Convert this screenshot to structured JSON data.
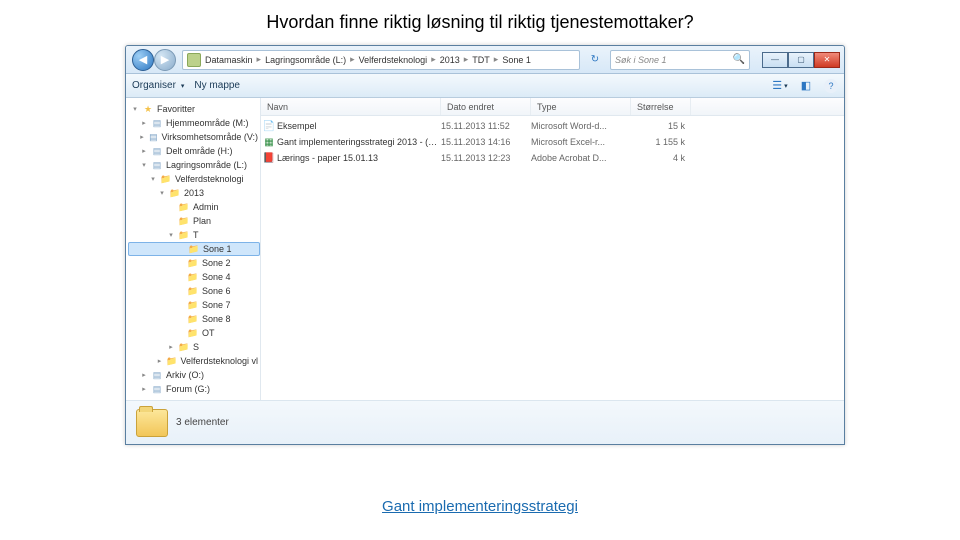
{
  "slide": {
    "title": "Hvordan finne riktig løsning til riktig tjenestemottaker?",
    "link": "Gant implementeringsstrategi"
  },
  "window": {
    "breadcrumb": [
      "Datamaskin",
      "Lagringsområde (L:)",
      "Velferdsteknologi",
      "2013",
      "TDT",
      "Sone 1"
    ],
    "search_placeholder": "Søk i Sone 1",
    "nav_back_glyph": "◀",
    "nav_fwd_glyph": "▶",
    "win_min": "—",
    "win_max": "▢",
    "win_close": "✕"
  },
  "toolbar": {
    "organize": "Organiser",
    "new_folder": "Ny mappe"
  },
  "columns": {
    "name": "Navn",
    "date": "Dato endret",
    "type": "Type",
    "size": "Størrelse"
  },
  "sidebar": [
    {
      "depth": 0,
      "arrow": "▾",
      "icon": "★",
      "cls": "ic-fav",
      "label": "Favoritter",
      "interact": true
    },
    {
      "depth": 1,
      "arrow": "▸",
      "icon": "▤",
      "cls": "ic-drv",
      "label": "Hjemmeområde (M:)",
      "interact": true
    },
    {
      "depth": 1,
      "arrow": "▸",
      "icon": "▤",
      "cls": "ic-drv",
      "label": "Virksomhetsområde (V:)",
      "interact": true
    },
    {
      "depth": 1,
      "arrow": "▸",
      "icon": "▤",
      "cls": "ic-drv",
      "label": "Delt område (H:)",
      "interact": true
    },
    {
      "depth": 1,
      "arrow": "▾",
      "icon": "▤",
      "cls": "ic-drv",
      "label": "Lagringsområde (L:)",
      "interact": true
    },
    {
      "depth": 2,
      "arrow": "▾",
      "icon": "📁",
      "cls": "ic-fold",
      "label": "Velferdsteknologi",
      "interact": true
    },
    {
      "depth": 3,
      "arrow": "▾",
      "icon": "📁",
      "cls": "ic-fold",
      "label": "2013",
      "interact": true
    },
    {
      "depth": 4,
      "arrow": " ",
      "icon": "📁",
      "cls": "ic-fold",
      "label": "Admin",
      "interact": true
    },
    {
      "depth": 4,
      "arrow": " ",
      "icon": "📁",
      "cls": "ic-fold",
      "label": "Plan",
      "interact": true
    },
    {
      "depth": 4,
      "arrow": "▾",
      "icon": "📁",
      "cls": "ic-fold",
      "label": "T",
      "interact": true
    },
    {
      "depth": 5,
      "arrow": " ",
      "icon": "📁",
      "cls": "ic-fold",
      "label": "Sone 1",
      "interact": true,
      "selected": true
    },
    {
      "depth": 5,
      "arrow": " ",
      "icon": "📁",
      "cls": "ic-fold",
      "label": "Sone 2",
      "interact": true
    },
    {
      "depth": 5,
      "arrow": " ",
      "icon": "📁",
      "cls": "ic-fold",
      "label": "Sone 4",
      "interact": true
    },
    {
      "depth": 5,
      "arrow": " ",
      "icon": "📁",
      "cls": "ic-fold",
      "label": "Sone 6",
      "interact": true
    },
    {
      "depth": 5,
      "arrow": " ",
      "icon": "📁",
      "cls": "ic-fold",
      "label": "Sone 7",
      "interact": true
    },
    {
      "depth": 5,
      "arrow": " ",
      "icon": "📁",
      "cls": "ic-fold",
      "label": "Sone 8",
      "interact": true
    },
    {
      "depth": 5,
      "arrow": " ",
      "icon": "📁",
      "cls": "ic-fold",
      "label": "OT",
      "interact": true
    },
    {
      "depth": 4,
      "arrow": "▸",
      "icon": "📁",
      "cls": "ic-fold",
      "label": "S",
      "interact": true
    },
    {
      "depth": 3,
      "arrow": "▸",
      "icon": "📁",
      "cls": "ic-fold",
      "label": "Velferdsteknologi vl",
      "interact": true
    },
    {
      "depth": 1,
      "arrow": "▸",
      "icon": "▤",
      "cls": "ic-drv",
      "label": "Arkiv (O:)",
      "interact": true
    },
    {
      "depth": 1,
      "arrow": "▸",
      "icon": "▤",
      "cls": "ic-drv",
      "label": "Forum (G:)",
      "interact": true
    }
  ],
  "files": [
    {
      "icon": "📄",
      "cls": "i-doc",
      "name": "Eksempel",
      "date": "15.11.2013 11:52",
      "type": "Microsoft Word-d...",
      "size": "15 k"
    },
    {
      "icon": "▦",
      "cls": "i-xls",
      "name": "Gant implementeringsstrategi 2013 - (1) ...",
      "date": "15.11.2013 14:16",
      "type": "Microsoft Excel-r...",
      "size": "1 155 k"
    },
    {
      "icon": "📕",
      "cls": "i-pdf",
      "name": "Lærings - paper 15.01.13",
      "date": "15.11.2013 12:23",
      "type": "Adobe Acrobat D...",
      "size": "4 k"
    }
  ],
  "details": {
    "count_label": "3 elementer"
  }
}
